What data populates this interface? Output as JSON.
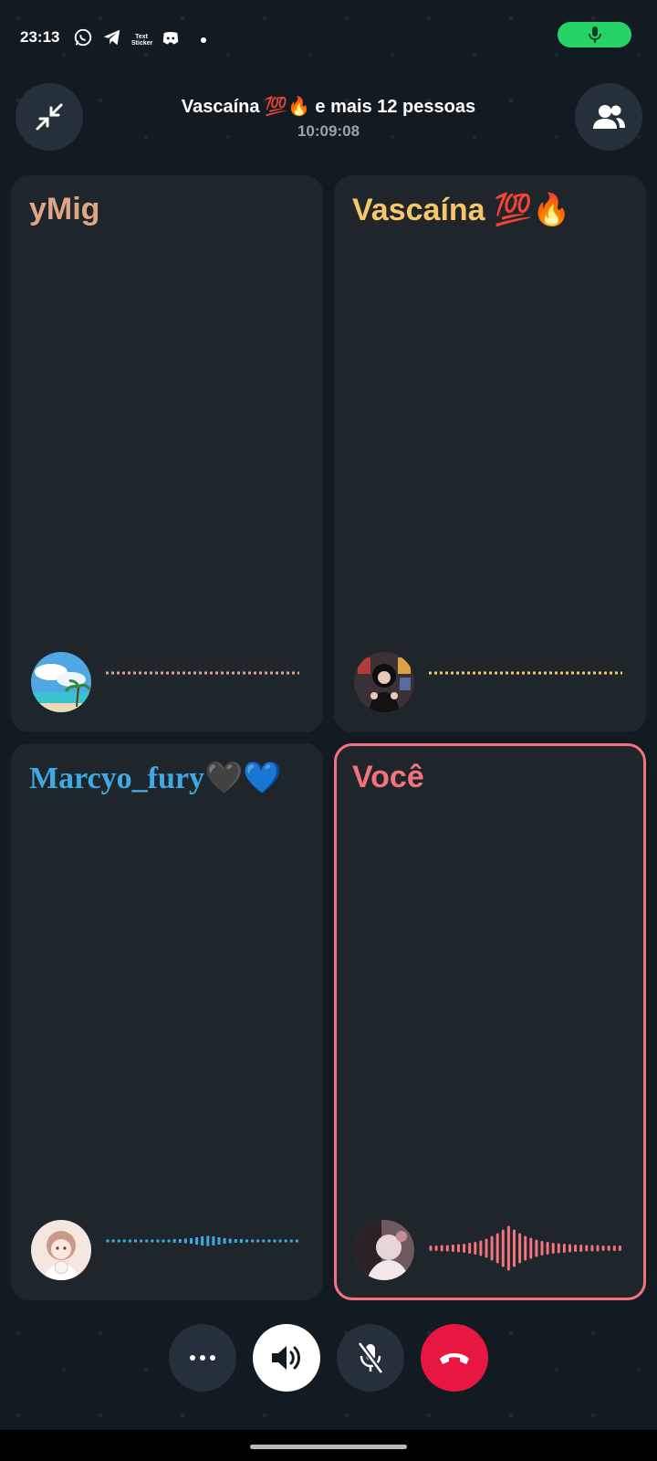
{
  "status_bar": {
    "time": "23:13",
    "sticker_label_1": "Text",
    "sticker_label_2": "Sticker",
    "mic_active_color": "#25d366"
  },
  "header": {
    "title": "Vascaína 💯🔥 e mais 12 pessoas",
    "duration": "10:09:08",
    "minimize_icon": "minimize-arrows-icon",
    "participants_icon": "people-icon"
  },
  "participants": [
    {
      "name": "yMig",
      "color": "#e0a585",
      "wave_style": "dotted"
    },
    {
      "name": "Vascaína 💯🔥",
      "color": "#f7c56a",
      "wave_style": "dotted"
    },
    {
      "name": "Marcyo_fury🖤💙",
      "color": "#3fa9e3",
      "wave_style": "low-activity"
    },
    {
      "name": "Você",
      "color": "#f4727b",
      "wave_style": "speaking",
      "active": true
    }
  ],
  "controls": {
    "more_icon": "more-icon",
    "speaker_icon": "speaker-icon",
    "mute_icon": "mic-muted-icon",
    "end_call_icon": "end-call-icon",
    "end_call_color": "#e8173f"
  }
}
